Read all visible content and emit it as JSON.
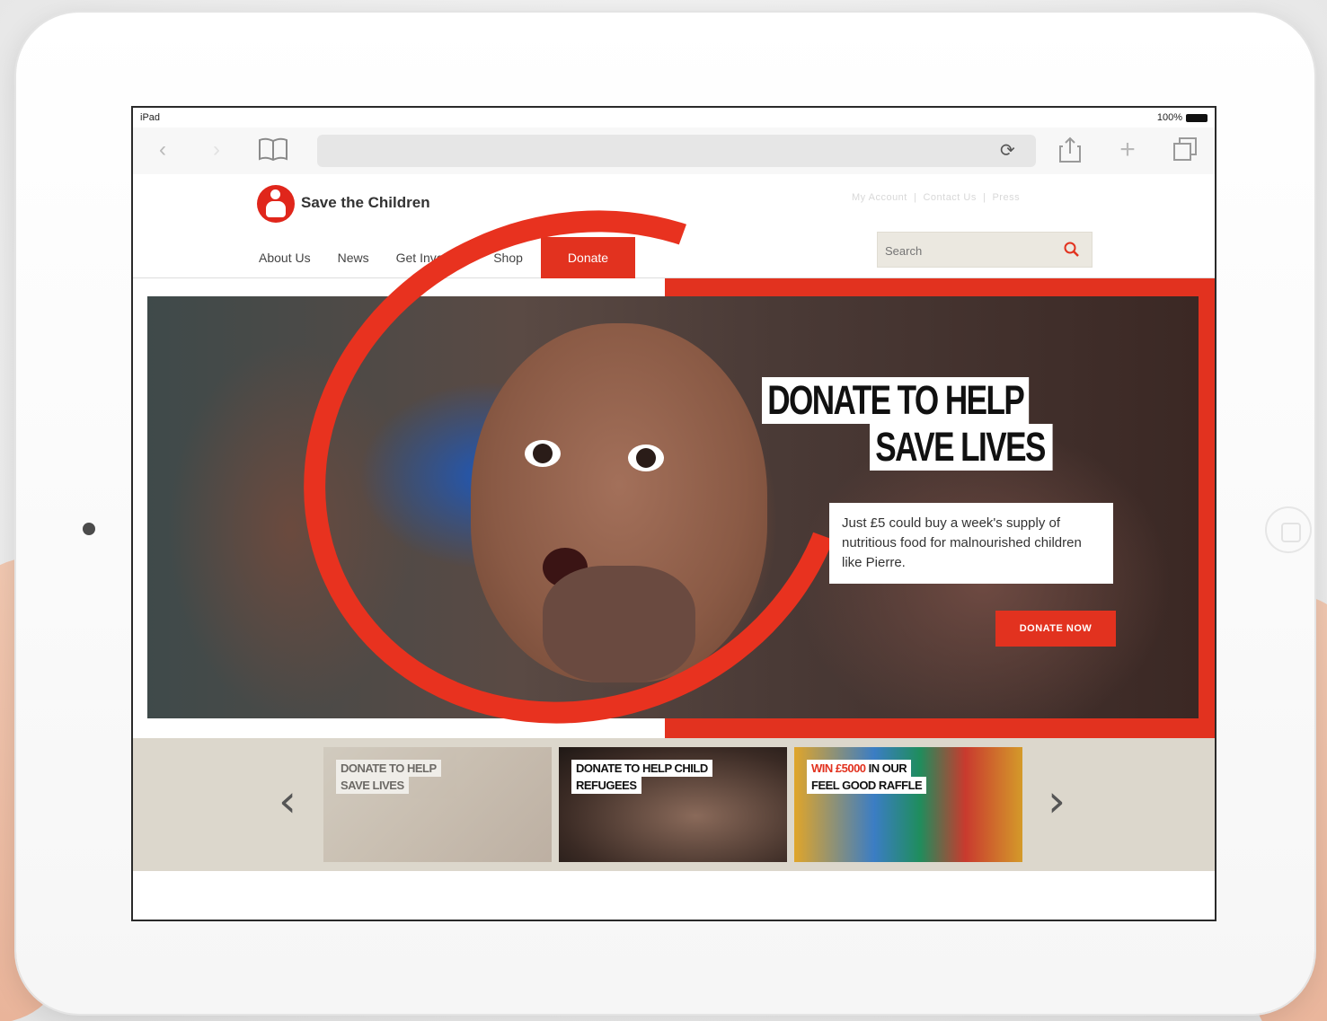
{
  "status_bar": {
    "device": "iPad",
    "battery": "100%"
  },
  "site": {
    "name": "Save the Children"
  },
  "utility_links": [
    "My Account",
    "Contact Us",
    "Press"
  ],
  "nav": {
    "items": [
      "About Us",
      "News",
      "Get Involved",
      "Shop"
    ],
    "donate_label": "Donate"
  },
  "search": {
    "placeholder": "Search"
  },
  "hero": {
    "headline_line1": "DONATE TO HELP",
    "headline_line2": "SAVE LIVES",
    "description": "Just £5 could buy a week's supply of nutritious food for malnourished children like Pierre.",
    "cta_label": "DONATE NOW"
  },
  "carousel": {
    "tiles": [
      {
        "line1": "DONATE TO HELP",
        "line1_highlight": "",
        "line2": "SAVE LIVES"
      },
      {
        "line1": "DONATE TO HELP CHILD",
        "line1_highlight": "",
        "line2": "REFUGEES"
      },
      {
        "line1": " IN OUR",
        "line1_highlight": "WIN £5000",
        "line2": "FEEL GOOD RAFFLE"
      }
    ]
  },
  "colors": {
    "accent": "#e2321f",
    "carousel_bg": "#dcd7cc"
  }
}
